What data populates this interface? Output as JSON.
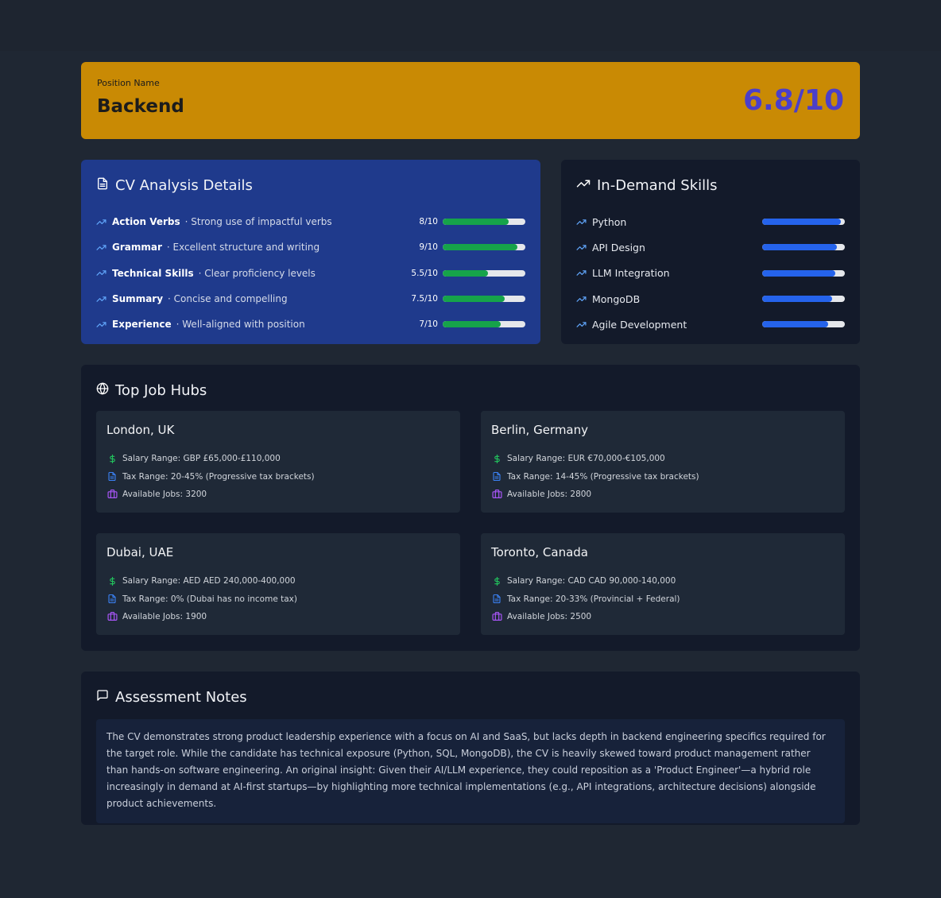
{
  "header": {
    "label": "Position Name",
    "title": "Backend",
    "score": "6.8/10"
  },
  "cv": {
    "title": "CV Analysis Details",
    "items": [
      {
        "name": "Action Verbs",
        "desc": "· Strong use of impactful verbs",
        "value": "8/10",
        "fraction": 0.8
      },
      {
        "name": "Grammar",
        "desc": "· Excellent structure and writing",
        "value": "9/10",
        "fraction": 0.9
      },
      {
        "name": "Technical Skills",
        "desc": "· Clear proficiency levels",
        "value": "5.5/10",
        "fraction": 0.55
      },
      {
        "name": "Summary",
        "desc": "· Concise and compelling",
        "value": "7.5/10",
        "fraction": 0.75
      },
      {
        "name": "Experience",
        "desc": "· Well-aligned with position",
        "value": "7/10",
        "fraction": 0.7
      }
    ]
  },
  "skills": {
    "title": "In-Demand Skills",
    "items": [
      {
        "name": "Python",
        "fraction": 0.95
      },
      {
        "name": "API Design",
        "fraction": 0.9
      },
      {
        "name": "LLM Integration",
        "fraction": 0.88
      },
      {
        "name": "MongoDB",
        "fraction": 0.85
      },
      {
        "name": "Agile Development",
        "fraction": 0.8
      }
    ]
  },
  "hubs": {
    "title": "Top Job Hubs",
    "items": [
      {
        "city": "London, UK",
        "salary": "Salary Range: GBP £65,000-£110,000",
        "tax": "Tax Range: 20-45% (Progressive tax brackets)",
        "jobs": "Available Jobs: 3200"
      },
      {
        "city": "Berlin, Germany",
        "salary": "Salary Range: EUR €70,000-€105,000",
        "tax": "Tax Range: 14-45% (Progressive tax brackets)",
        "jobs": "Available Jobs: 2800"
      },
      {
        "city": "Dubai, UAE",
        "salary": "Salary Range: AED AED 240,000-400,000",
        "tax": "Tax Range: 0% (Dubai has no income tax)",
        "jobs": "Available Jobs: 1900"
      },
      {
        "city": "Toronto, Canada",
        "salary": "Salary Range: CAD CAD 90,000-140,000",
        "tax": "Tax Range: 20-33% (Provincial + Federal)",
        "jobs": "Available Jobs: 2500"
      }
    ]
  },
  "notes": {
    "title": "Assessment Notes",
    "text": "The CV demonstrates strong product leadership experience with a focus on AI and SaaS, but lacks depth in backend engineering specifics required for the target role. While the candidate has technical exposure (Python, SQL, MongoDB), the CV is heavily skewed toward product management rather than hands-on software engineering. An original insight: Given their AI/LLM experience, they could reposition as a 'Product Engineer'—a hybrid role increasingly in demand at AI-first startups—by highlighting more technical implementations (e.g., API integrations, architecture decisions) alongside product achievements."
  },
  "colors": {
    "header_bg": "#c98a04",
    "score": "#4b3fc9",
    "cv_card_bg": "#1f3a8c",
    "cv_bar": "#16a34a",
    "skill_bar": "#2563eb",
    "salary_icon": "#22c55e",
    "tax_icon": "#3b82f6",
    "jobs_icon": "#a855f7"
  }
}
